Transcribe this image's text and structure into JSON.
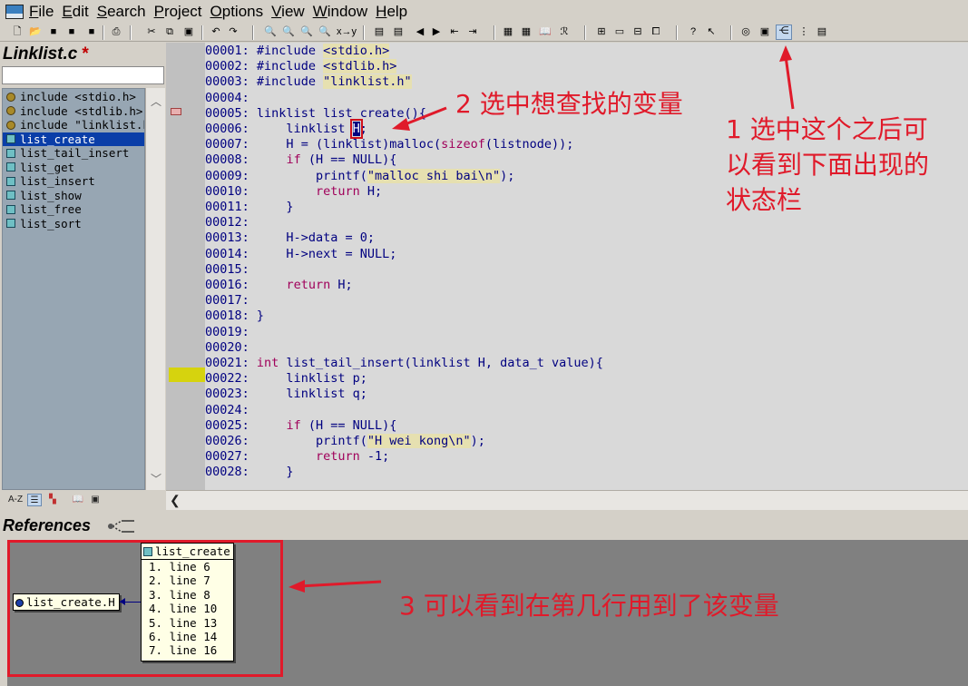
{
  "menubar": {
    "items": [
      "File",
      "Edit",
      "Search",
      "Project",
      "Options",
      "View",
      "Window",
      "Help"
    ]
  },
  "toolbar": {
    "selected_button_icon": "relation-window-icon"
  },
  "left_panel": {
    "file_title": "Linklist.c",
    "modified_marker": "*",
    "symbol_filter_value": "",
    "symbols": [
      {
        "label": "include <stdio.h>",
        "kind": "include"
      },
      {
        "label": "include <stdlib.h>",
        "kind": "include"
      },
      {
        "label": "include \"linklist.h\"",
        "kind": "include"
      },
      {
        "label": "list_create",
        "kind": "function",
        "selected": true
      },
      {
        "label": "list_tail_insert",
        "kind": "function"
      },
      {
        "label": "list_get",
        "kind": "function"
      },
      {
        "label": "list_insert",
        "kind": "function"
      },
      {
        "label": "list_show",
        "kind": "function"
      },
      {
        "label": "list_free",
        "kind": "function"
      },
      {
        "label": "list_sort",
        "kind": "function"
      }
    ],
    "tabs": [
      "A-Z",
      "list",
      "symbols",
      "book",
      "project"
    ]
  },
  "editor": {
    "lines": [
      {
        "num": "00001:",
        "code": "#include <stdio.h>"
      },
      {
        "num": "00002:",
        "code": "#include <stdlib.h>"
      },
      {
        "num": "00003:",
        "code": "#include \"linklist.h\""
      },
      {
        "num": "00004:",
        "code": ""
      },
      {
        "num": "00005:",
        "code": "linklist list_create(){"
      },
      {
        "num": "00006:",
        "code": "    linklist H;"
      },
      {
        "num": "00007:",
        "code": "    H = (linklist)malloc(sizeof(listnode));"
      },
      {
        "num": "00008:",
        "code": "    if (H == NULL){"
      },
      {
        "num": "00009:",
        "code": "        printf(\"malloc shi bai\\n\");"
      },
      {
        "num": "00010:",
        "code": "        return H;"
      },
      {
        "num": "00011:",
        "code": "    }"
      },
      {
        "num": "00012:",
        "code": ""
      },
      {
        "num": "00013:",
        "code": "    H->data = 0;"
      },
      {
        "num": "00014:",
        "code": "    H->next = NULL;"
      },
      {
        "num": "00015:",
        "code": ""
      },
      {
        "num": "00016:",
        "code": "    return H;"
      },
      {
        "num": "00017:",
        "code": ""
      },
      {
        "num": "00018:",
        "code": "}"
      },
      {
        "num": "00019:",
        "code": ""
      },
      {
        "num": "00020:",
        "code": ""
      },
      {
        "num": "00021:",
        "code": "int list_tail_insert(linklist H, data_t value){"
      },
      {
        "num": "00022:",
        "code": "    linklist p;"
      },
      {
        "num": "00023:",
        "code": "    linklist q;"
      },
      {
        "num": "00024:",
        "code": ""
      },
      {
        "num": "00025:",
        "code": "    if (H == NULL){"
      },
      {
        "num": "00026:",
        "code": "        printf(\"H wei kong\\n\");"
      },
      {
        "num": "00027:",
        "code": "        return -1;"
      },
      {
        "num": "00028:",
        "code": "    }"
      }
    ]
  },
  "references": {
    "title": "References",
    "root_label": "list_create.H",
    "node_title": "list_create",
    "lines": [
      "1. line 6",
      "2. line 7",
      "3. line 8",
      "4. line 10",
      "5. line 13",
      "6. line 14",
      "7. line 16"
    ]
  },
  "annotations": {
    "step1_line1": "1 选中这个之后可",
    "step1_line2": "以看到下面出现的",
    "step1_line3": "状态栏",
    "step2": "2 选中想查找的变量",
    "step3": "3 可以看到在第几行用到了该变量",
    "color": "#e01a2a"
  }
}
